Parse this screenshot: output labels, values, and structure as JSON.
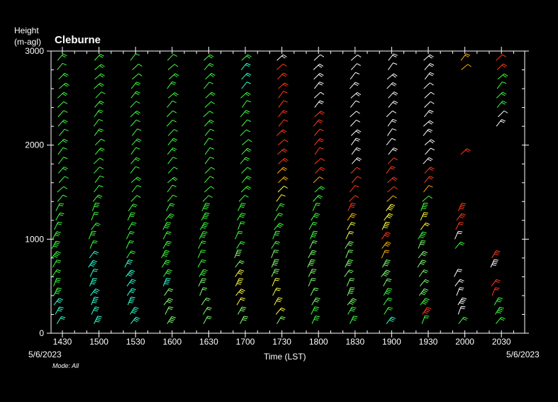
{
  "chart_data": {
    "type": "wind-barb profile time-height",
    "title": "Cleburne",
    "ylabel_line1": "Height",
    "ylabel_line2": "(m-agl)",
    "xlabel": "Time (LST)",
    "date_left": "5/6/2023",
    "date_right": "5/6/2023",
    "mode_label": "Mode: All",
    "ylim": [
      0,
      3000
    ],
    "yticks": [
      "0",
      "1000",
      "2000",
      "3000"
    ],
    "xticks": [
      "1430",
      "1500",
      "1530",
      "1600",
      "1630",
      "1700",
      "1730",
      "1800",
      "1830",
      "1900",
      "1930",
      "2000",
      "2030"
    ],
    "colors": {
      "green": "#3cff3c",
      "light_green": "#7dff6e",
      "cyan": "#30ffd0",
      "yellow": "#ffff3c",
      "orange": "#ffb000",
      "red": "#ff3a1a",
      "white": "#ffffff"
    },
    "profiles": [
      {
        "time": "1430",
        "colors": [
          "cyan",
          "cyan",
          "cyan",
          "green",
          "green",
          "green",
          "green",
          "green",
          "green",
          "green",
          "green",
          "green",
          "green",
          "green",
          "green",
          "green",
          "green",
          "green",
          "green",
          "green",
          "green",
          "green",
          "green",
          "green",
          "green",
          "green",
          "green",
          "green",
          "green"
        ]
      },
      {
        "time": "1500",
        "colors": [
          "cyan",
          "cyan",
          "cyan",
          "cyan",
          "cyan",
          "cyan",
          "cyan",
          "cyan",
          "green",
          "green",
          "green",
          "green",
          "green",
          "green",
          "green",
          "green",
          "green",
          "green",
          "green",
          "green",
          "green",
          "green",
          "green",
          "green",
          "green",
          "green",
          "green",
          "green",
          "green"
        ]
      },
      {
        "time": "1530",
        "colors": [
          "cyan",
          "cyan",
          "cyan",
          "cyan",
          "cyan",
          "cyan",
          "cyan",
          "green",
          "green",
          "green",
          "green",
          "green",
          "green",
          "green",
          "green",
          "green",
          "green",
          "green",
          "green",
          "green",
          "green",
          "green",
          "green",
          "green",
          "green",
          "green",
          "green",
          "green",
          "green"
        ]
      },
      {
        "time": "1600",
        "colors": [
          "light_green",
          "light_green",
          "light_green",
          "light_green",
          "cyan",
          "green",
          "green",
          "green",
          "green",
          "green",
          "green",
          "green",
          "green",
          "green",
          "green",
          "green",
          "green",
          "green",
          "green",
          "green",
          "green",
          "green",
          "green",
          "green",
          "green",
          "green",
          "green",
          "green",
          "green"
        ]
      },
      {
        "time": "1630",
        "colors": [
          "light_green",
          "light_green",
          "light_green",
          "light_green",
          "light_green",
          "green",
          "green",
          "green",
          "green",
          "green",
          "green",
          "green",
          "green",
          "green",
          "green",
          "green",
          "green",
          "green",
          "green",
          "green",
          "green",
          "green",
          "green",
          "green",
          "green",
          "green",
          "green",
          "green",
          "green"
        ]
      },
      {
        "time": "1700",
        "colors": [
          "light_green",
          "light_green",
          "yellow",
          "yellow",
          "yellow",
          "yellow",
          "light_green",
          "light_green",
          "green",
          "green",
          "green",
          "green",
          "green",
          "green",
          "green",
          "green",
          "green",
          "green",
          "green",
          "green",
          "green",
          "green",
          "green",
          "green",
          "green",
          "cyan",
          "cyan",
          "cyan",
          "green"
        ]
      },
      {
        "time": "1730",
        "colors": [
          "light_green",
          "yellow",
          "yellow",
          "yellow",
          "yellow",
          "light_green",
          "light_green",
          "light_green",
          "green",
          "green",
          "green",
          "green",
          "green",
          "yellow",
          "yellow",
          "orange",
          "orange",
          "red",
          "red",
          "red",
          "red",
          "red",
          "red",
          "red",
          "red",
          "red",
          "red",
          "red",
          "white"
        ]
      },
      {
        "time": "1800",
        "colors": [
          "green",
          "green",
          "light_green",
          "light_green",
          "light_green",
          "light_green",
          "light_green",
          "light_green",
          "light_green",
          "green",
          "green",
          "green",
          "green",
          "green",
          "green",
          "orange",
          "red",
          "red",
          "red",
          "red",
          "red",
          "red",
          "red",
          "white",
          "white",
          "white",
          "white",
          "white",
          "white"
        ]
      },
      {
        "time": "1830",
        "colors": [
          "green",
          "green",
          "light_green",
          "light_green",
          "light_green",
          "light_green",
          "light_green",
          "light_green",
          "light_green",
          "yellow",
          "yellow",
          "orange",
          "red",
          "red",
          "red",
          "red",
          "red",
          "white",
          "white",
          "white",
          "white",
          "white",
          "white",
          "white",
          "white",
          "white",
          "white",
          "white",
          "white"
        ]
      },
      {
        "time": "1900",
        "colors": [
          "cyan",
          "green",
          "green",
          "green",
          "light_green",
          "light_green",
          "light_green",
          "orange",
          "orange",
          "red",
          "yellow",
          "yellow",
          "yellow",
          "orange",
          "red",
          "red",
          "red",
          "red",
          "white",
          "white",
          "white",
          "white",
          "white",
          "white",
          "white",
          "white",
          "white",
          "white",
          "white"
        ]
      },
      {
        "time": "1930",
        "colors": [
          "green",
          "red",
          "green",
          "light_green",
          "light_green",
          "light_green",
          "light_green",
          "light_green",
          "light_green",
          "green",
          "yellow",
          "yellow",
          "green",
          "green",
          "orange",
          "red",
          "red",
          "white",
          "white",
          "white",
          "white",
          "white",
          "white",
          "white",
          "white",
          "white",
          "white",
          "white",
          "white"
        ]
      },
      {
        "time": "2000",
        "colors": [
          "green",
          "white",
          "white",
          "white",
          "white",
          "white",
          "none",
          "none",
          "green",
          "white",
          "red",
          "red",
          "red",
          "none",
          "none",
          "none",
          "none",
          "none",
          "red",
          "none",
          "none",
          "none",
          "none",
          "none",
          "none",
          "none",
          "none",
          "orange",
          "orange"
        ]
      },
      {
        "time": "2030",
        "colors": [
          "green",
          "green",
          "green",
          "red",
          "red",
          "none",
          "white",
          "red",
          "none",
          "none",
          "none",
          "none",
          "none",
          "none",
          "none",
          "none",
          "none",
          "none",
          "none",
          "none",
          "none",
          "white",
          "white",
          "green",
          "green",
          "green",
          "green",
          "red",
          "red"
        ]
      }
    ]
  }
}
